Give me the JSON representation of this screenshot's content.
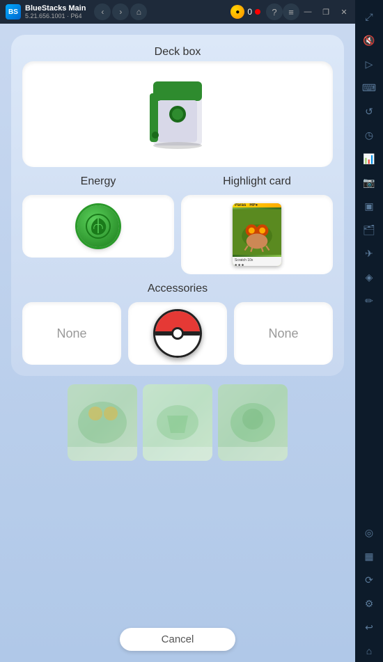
{
  "titlebar": {
    "app_name": "BlueStacks Main",
    "app_version": "5.21.656.1001 · P64",
    "coin_count": "0",
    "nav_back": "‹",
    "nav_forward": "›",
    "nav_home": "⌂",
    "help": "?",
    "menu": "≡",
    "minimize": "—",
    "restore": "❐",
    "close": "✕"
  },
  "sidebar": {
    "icons": [
      {
        "name": "expand-icon",
        "symbol": "⤢"
      },
      {
        "name": "volume-icon",
        "symbol": "🔇"
      },
      {
        "name": "play-icon",
        "symbol": "▷"
      },
      {
        "name": "keyboard-icon",
        "symbol": "⌨"
      },
      {
        "name": "rotate-icon",
        "symbol": "↺"
      },
      {
        "name": "history-icon",
        "symbol": "◷"
      },
      {
        "name": "chart-icon",
        "symbol": "📊"
      },
      {
        "name": "camera-icon",
        "symbol": "📷"
      },
      {
        "name": "screen-icon",
        "symbol": "▣"
      },
      {
        "name": "folder-icon",
        "symbol": "🗂"
      },
      {
        "name": "airplane-icon",
        "symbol": "✈"
      },
      {
        "name": "location-icon",
        "symbol": "✦"
      },
      {
        "name": "eraser-icon",
        "symbol": "✏"
      },
      {
        "name": "pin-icon",
        "symbol": "📍"
      },
      {
        "name": "box-icon",
        "symbol": "📦"
      },
      {
        "name": "refresh-icon",
        "symbol": "⟳"
      },
      {
        "name": "settings-icon",
        "symbol": "⚙"
      },
      {
        "name": "back-icon",
        "symbol": "↩"
      },
      {
        "name": "home-icon",
        "symbol": "⌂"
      }
    ]
  },
  "content": {
    "deck_box_label": "Deck box",
    "energy_label": "Energy",
    "highlight_card_label": "Highlight card",
    "accessories_label": "Accessories",
    "none_left": "None",
    "none_right": "None",
    "cancel_label": "Cancel"
  }
}
